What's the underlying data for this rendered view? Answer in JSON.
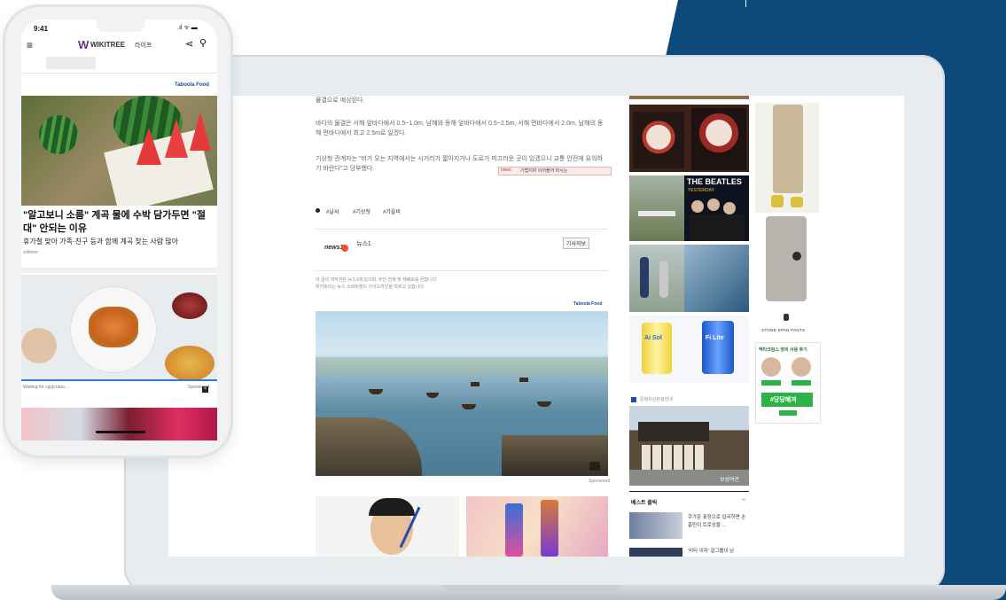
{
  "phone": {
    "status_time": "9:41",
    "brand": "WIKITREE",
    "brand_sub": "라이프",
    "taboola": "Taboola Food",
    "story1": {
      "headline": "\"알고보니 소름\" 계곡 물에 수박 담가두면 \"절대\" 안되는 이유",
      "sub": "휴가철 맞아 가족·친구 등과 함께 계곡 찾는 사람 많아",
      "source": "wikitree"
    },
    "waiting": "Waiting for cgyp.tabo...",
    "sponsored": "Sponsored"
  },
  "article": {
    "para0": "물결으로 예상된다.",
    "para1": "바다의 물결은 서해 앞바다에서 0.5~1.0m, 남해와 동해 앞바다에서 0.5~2.5m, 서해 먼바다에서 2.0m, 남해의 동해 먼바다에서 최고 2.5m로 일겠다.",
    "para2": "기상청 관계자는 \"비가 오는 지역에서는 시거리가 짧아지거나 도로가 미끄러운 곳이 있겠으니 교통 안전에 유의하기 바란다\"고 당부했다.",
    "inline_ad": "가볍지마 이어볼까 마시는",
    "tags": [
      "#날씨",
      "#기상청",
      "#가을비"
    ],
    "press_logo": "news1",
    "press_name": "뉴스1",
    "subscribe": "기사저보",
    "notice1": "이 글의 저작권은 뉴스1에 있으며, 무단 전재 및 재배포를 금합니다.",
    "notice2": "위키트리는 뉴스 소비트렌드 가이드라인을 따르고 있습니다.",
    "taboola": "Taboola Food",
    "sponsored": "Sponsored"
  },
  "sidebar": {
    "beatles_title": "THE BEATLES",
    "beatles_sub": "YESTERDAY",
    "can1": "Ai Sol",
    "can2": "Fi Lite",
    "tour_label": "문화유산관광안내",
    "photo_caption": "보성여관",
    "best_title": "베스트 클릭",
    "best_items": [
      "쿠가운 표정으로 입국하면 손흥민이 트로상을 ...",
      "'리타 이자' 걸그룹이 남"
    ]
  },
  "ads": {
    "pants_brand": "STONE SPAN PANTS",
    "promo_title": "맥타크림스 영의 사용 후기",
    "promo_cta": "#당당해져"
  },
  "colors": {
    "backdrop": "#0d4a7b",
    "promo_green": "#2bb34a",
    "pink_badge": "#d6336c"
  }
}
